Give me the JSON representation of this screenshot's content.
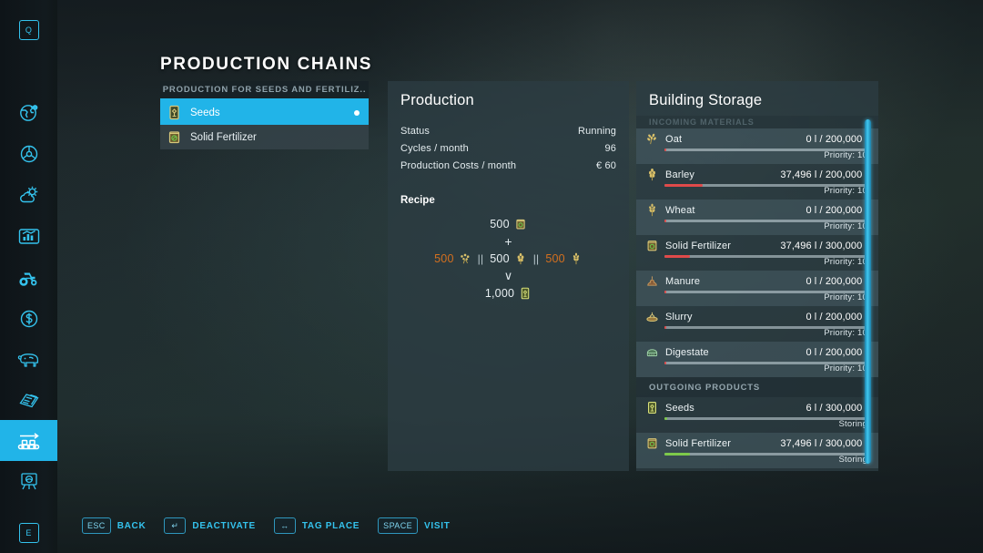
{
  "page": {
    "title": "PRODUCTION CHAINS"
  },
  "sidebar": {
    "items": [
      {
        "name": "map-marker-key",
        "label": "Q"
      },
      {
        "name": "globe-settings",
        "label": ""
      },
      {
        "name": "steering-wheel",
        "label": ""
      },
      {
        "name": "weather-cloud-sun",
        "label": ""
      },
      {
        "name": "statistics-chart",
        "label": ""
      },
      {
        "name": "vehicles-tractor",
        "label": ""
      },
      {
        "name": "finances-dollar",
        "label": ""
      },
      {
        "name": "animals-cow",
        "label": ""
      },
      {
        "name": "contracts-papers",
        "label": ""
      },
      {
        "name": "production-conveyor",
        "label": ""
      },
      {
        "name": "construction-easel",
        "label": ""
      },
      {
        "name": "help-key-e",
        "label": "E"
      }
    ],
    "active_index": 9
  },
  "production_list": {
    "header": "PRODUCTION FOR SEEDS AND FERTILIZ..",
    "rows": [
      {
        "label": "Seeds",
        "icon": "seed-bag-icon",
        "selected": true,
        "indicator": true
      },
      {
        "label": "Solid Fertilizer",
        "icon": "fertilizer-bag-icon",
        "selected": false,
        "indicator": false
      }
    ]
  },
  "production": {
    "title": "Production",
    "stats": [
      {
        "label": "Status",
        "value": "Running"
      },
      {
        "label": "Cycles / month",
        "value": "96"
      },
      {
        "label": "Production Costs / month",
        "value": "€ 60"
      }
    ],
    "recipe": {
      "title": "Recipe",
      "input_primary": {
        "amount": "500",
        "icon": "fertilizer-bag-icon",
        "low": false
      },
      "plus": "+",
      "alternatives": [
        {
          "amount": "500",
          "icon": "canola-icon",
          "low": true
        },
        {
          "amount": "500",
          "icon": "barley-icon",
          "low": false
        },
        {
          "amount": "500",
          "icon": "wheat-icon",
          "low": true
        }
      ],
      "separator": "||",
      "arrow": "∨",
      "output": {
        "amount": "1,000",
        "icon": "seed-bag-icon"
      }
    }
  },
  "storage": {
    "title": "Building Storage",
    "sections": [
      {
        "header": "INCOMING MATERIALS",
        "clipped": true,
        "rows": [
          {
            "name": "Oat",
            "icon": "oat-icon",
            "qty": "0 l / 200,000 l",
            "sub": "Priority: 10",
            "fill_pct": 1,
            "fill_state": "low"
          },
          {
            "name": "Barley",
            "icon": "barley-icon",
            "qty": "37,496 l / 200,000 l",
            "sub": "Priority: 10",
            "fill_pct": 18.7,
            "fill_state": "low"
          },
          {
            "name": "Wheat",
            "icon": "wheat-icon",
            "qty": "0 l / 200,000 l",
            "sub": "Priority: 10",
            "fill_pct": 1,
            "fill_state": "low"
          },
          {
            "name": "Solid Fertilizer",
            "icon": "fertilizer-bag-icon",
            "qty": "37,496 l / 300,000 l",
            "sub": "Priority: 10",
            "fill_pct": 12.5,
            "fill_state": "low"
          },
          {
            "name": "Manure",
            "icon": "manure-icon",
            "qty": "0 l / 200,000 l",
            "sub": "Priority: 10",
            "fill_pct": 1,
            "fill_state": "low"
          },
          {
            "name": "Slurry",
            "icon": "slurry-icon",
            "qty": "0 l / 200,000 l",
            "sub": "Priority: 10",
            "fill_pct": 1,
            "fill_state": "low"
          },
          {
            "name": "Digestate",
            "icon": "digestate-icon",
            "qty": "0 l / 200,000 l",
            "sub": "Priority: 10",
            "fill_pct": 1,
            "fill_state": "low"
          }
        ]
      },
      {
        "header": "OUTGOING PRODUCTS",
        "clipped": false,
        "rows": [
          {
            "name": "Seeds",
            "icon": "seed-bag-icon",
            "qty": "6 l / 300,000 l",
            "sub": "Storing",
            "fill_pct": 1.5,
            "fill_state": "good"
          },
          {
            "name": "Solid Fertilizer",
            "icon": "fertilizer-bag-icon",
            "qty": "37,496 l / 300,000 l",
            "sub": "Storing",
            "fill_pct": 12.5,
            "fill_state": "good"
          }
        ]
      }
    ]
  },
  "helpbar": {
    "items": [
      {
        "key": "ESC",
        "label": "BACK"
      },
      {
        "key": "↵",
        "label": "DEACTIVATE"
      },
      {
        "key": "↔",
        "label": "TAG PLACE"
      },
      {
        "key": "SPACE",
        "label": "VISIT"
      }
    ]
  },
  "colors": {
    "accent": "#21b4e8",
    "accent_text": "#34c3ee",
    "panel_bg": "#2c3c42",
    "bar_low": "#e04a4a",
    "bar_good": "#7dc94a",
    "amount_low": "#d4701f"
  }
}
